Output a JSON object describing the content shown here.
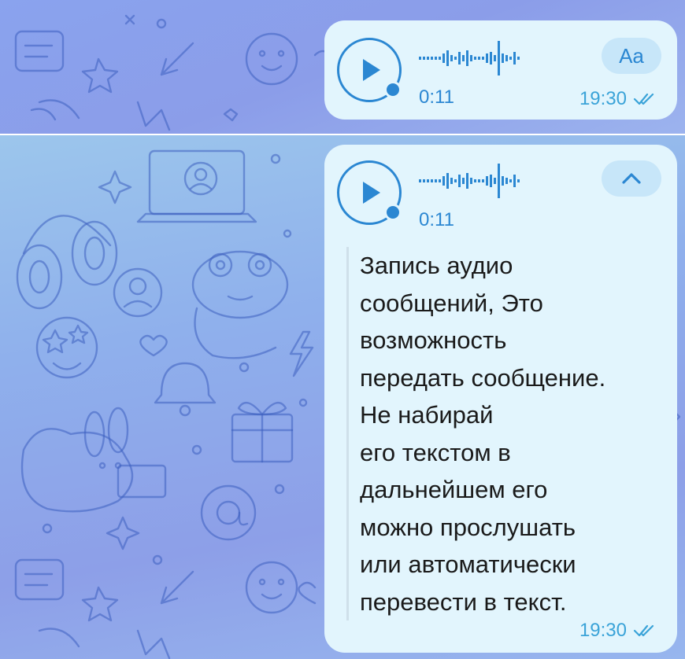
{
  "messages": [
    {
      "duration": "0:11",
      "time": "19:30",
      "transcribe_button_label": "Aa",
      "read_status_icon": "double-check-icon",
      "play_icon": "play-icon"
    },
    {
      "duration": "0:11",
      "time": "19:30",
      "collapse_icon": "chevron-up-icon",
      "read_status_icon": "double-check-icon",
      "play_icon": "play-icon",
      "transcript_lines": [
        "Запись аудио",
        "сообщений, Это",
        "возможность",
        "передать сообщение.",
        "Не набирай",
        "его текстом в",
        "дальнейшем его",
        "можно прослушать",
        "или автоматически",
        "перевести в текст."
      ]
    }
  ],
  "colors": {
    "accent": "#2b87d2",
    "bubble": "#e2f5fd",
    "time": "#3aa3d8",
    "background_doodle": "#3d5fbf"
  }
}
